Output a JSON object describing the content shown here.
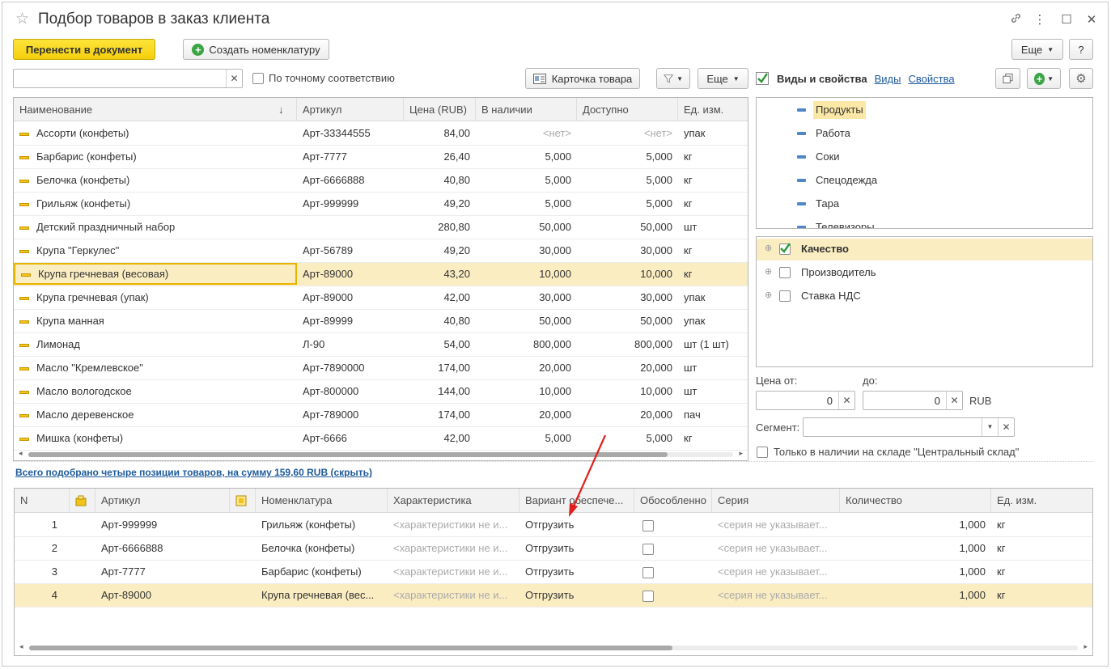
{
  "window": {
    "title": "Подбор товаров в заказ клиента"
  },
  "toolbar": {
    "transfer_label": "Перенести в документ",
    "create_label": "Создать номенклатуру",
    "more_label": "Еще",
    "help_label": "?"
  },
  "search": {
    "value": "",
    "exact_match_label": "По точному соответствию",
    "card_label": "Карточка товара",
    "more_label": "Еще"
  },
  "products": {
    "columns": [
      "Наименование",
      "Артикул",
      "Цена (RUB)",
      "В наличии",
      "Доступно",
      "Ед. изм."
    ],
    "rows": [
      {
        "name": "Ассорти (конфеты)",
        "sku": "Арт-33344555",
        "price": "84,00",
        "stock": "<нет>",
        "avail": "<нет>",
        "unit": "упак"
      },
      {
        "name": "Барбарис (конфеты)",
        "sku": "Арт-7777",
        "price": "26,40",
        "stock": "5,000",
        "avail": "5,000",
        "unit": "кг"
      },
      {
        "name": "Белочка (конфеты)",
        "sku": "Арт-6666888",
        "price": "40,80",
        "stock": "5,000",
        "avail": "5,000",
        "unit": "кг"
      },
      {
        "name": "Грильяж (конфеты)",
        "sku": "Арт-999999",
        "price": "49,20",
        "stock": "5,000",
        "avail": "5,000",
        "unit": "кг"
      },
      {
        "name": "Детский праздничный набор",
        "sku": "",
        "price": "280,80",
        "stock": "50,000",
        "avail": "50,000",
        "unit": "шт"
      },
      {
        "name": "Крупа \"Геркулес\"",
        "sku": "Арт-56789",
        "price": "49,20",
        "stock": "30,000",
        "avail": "30,000",
        "unit": "кг"
      },
      {
        "name": "Крупа гречневая (весовая)",
        "sku": "Арт-89000",
        "price": "43,20",
        "stock": "10,000",
        "avail": "10,000",
        "unit": "кг"
      },
      {
        "name": "Крупа гречневая (упак)",
        "sku": "Арт-89000",
        "price": "42,00",
        "stock": "30,000",
        "avail": "30,000",
        "unit": "упак"
      },
      {
        "name": "Крупа манная",
        "sku": "Арт-89999",
        "price": "40,80",
        "stock": "50,000",
        "avail": "50,000",
        "unit": "упак"
      },
      {
        "name": "Лимонад",
        "sku": "Л-90",
        "price": "54,00",
        "stock": "800,000",
        "avail": "800,000",
        "unit": "шт (1 шт)"
      },
      {
        "name": "Масло \"Кремлевское\"",
        "sku": "Арт-7890000",
        "price": "174,00",
        "stock": "20,000",
        "avail": "20,000",
        "unit": "шт"
      },
      {
        "name": "Масло вологодское",
        "sku": "Арт-800000",
        "price": "144,00",
        "stock": "10,000",
        "avail": "10,000",
        "unit": "шт"
      },
      {
        "name": "Масло деревенское",
        "sku": "Арт-789000",
        "price": "174,00",
        "stock": "20,000",
        "avail": "20,000",
        "unit": "пач"
      },
      {
        "name": "Мишка (конфеты)",
        "sku": "Арт-6666",
        "price": "42,00",
        "stock": "5,000",
        "avail": "5,000",
        "unit": "кг"
      }
    ]
  },
  "filters": {
    "title": "Виды и свойства",
    "kinds_link": "Виды",
    "props_link": "Свойства",
    "kinds": [
      "Продукты",
      "Работа",
      "Соки",
      "Спецодежда",
      "Тара",
      "Телевизоры"
    ],
    "properties": [
      {
        "label": "Качество",
        "checked": true
      },
      {
        "label": "Производитель",
        "checked": false
      },
      {
        "label": "Ставка НДС",
        "checked": false
      }
    ],
    "price_from_label": "Цена от:",
    "price_to_label": "до:",
    "price_from": "0",
    "price_to": "0",
    "currency": "RUB",
    "segment_label": "Сегмент:",
    "in_stock_label": "Только в наличии на складе \"Центральный склад\""
  },
  "summary": {
    "text": "Всего подобрано четыре позиции товаров, на сумму 159,60 RUB (скрыть)"
  },
  "selected": {
    "columns": [
      "N",
      "Артикул",
      "Номенклатура",
      "Характеристика",
      "Вариант обеспече...",
      "Обособленно",
      "Серия",
      "Количество",
      "Ед. изм."
    ],
    "rows": [
      {
        "n": "1",
        "sku": "Арт-999999",
        "name": "Грильяж (конфеты)",
        "char": "<характеристики не и...",
        "variant": "Отгрузить",
        "series": "<серия не указывает...",
        "qty": "1,000",
        "unit": "кг"
      },
      {
        "n": "2",
        "sku": "Арт-6666888",
        "name": "Белочка (конфеты)",
        "char": "<характеристики не и...",
        "variant": "Отгрузить",
        "series": "<серия не указывает...",
        "qty": "1,000",
        "unit": "кг"
      },
      {
        "n": "3",
        "sku": "Арт-7777",
        "name": "Барбарис (конфеты)",
        "char": "<характеристики не и...",
        "variant": "Отгрузить",
        "series": "<серия не указывает...",
        "qty": "1,000",
        "unit": "кг"
      },
      {
        "n": "4",
        "sku": "Арт-89000",
        "name": "Крупа гречневая (вес...",
        "char": "<характеристики не и...",
        "variant": "Отгрузить",
        "series": "<серия не указывает...",
        "qty": "1,000",
        "unit": "кг"
      }
    ]
  },
  "colors": {
    "accent_yellow": "#f4cf0c",
    "selection": "#fbedc2",
    "link": "#1d5a9c",
    "annotation_arrow": "#e02020"
  }
}
